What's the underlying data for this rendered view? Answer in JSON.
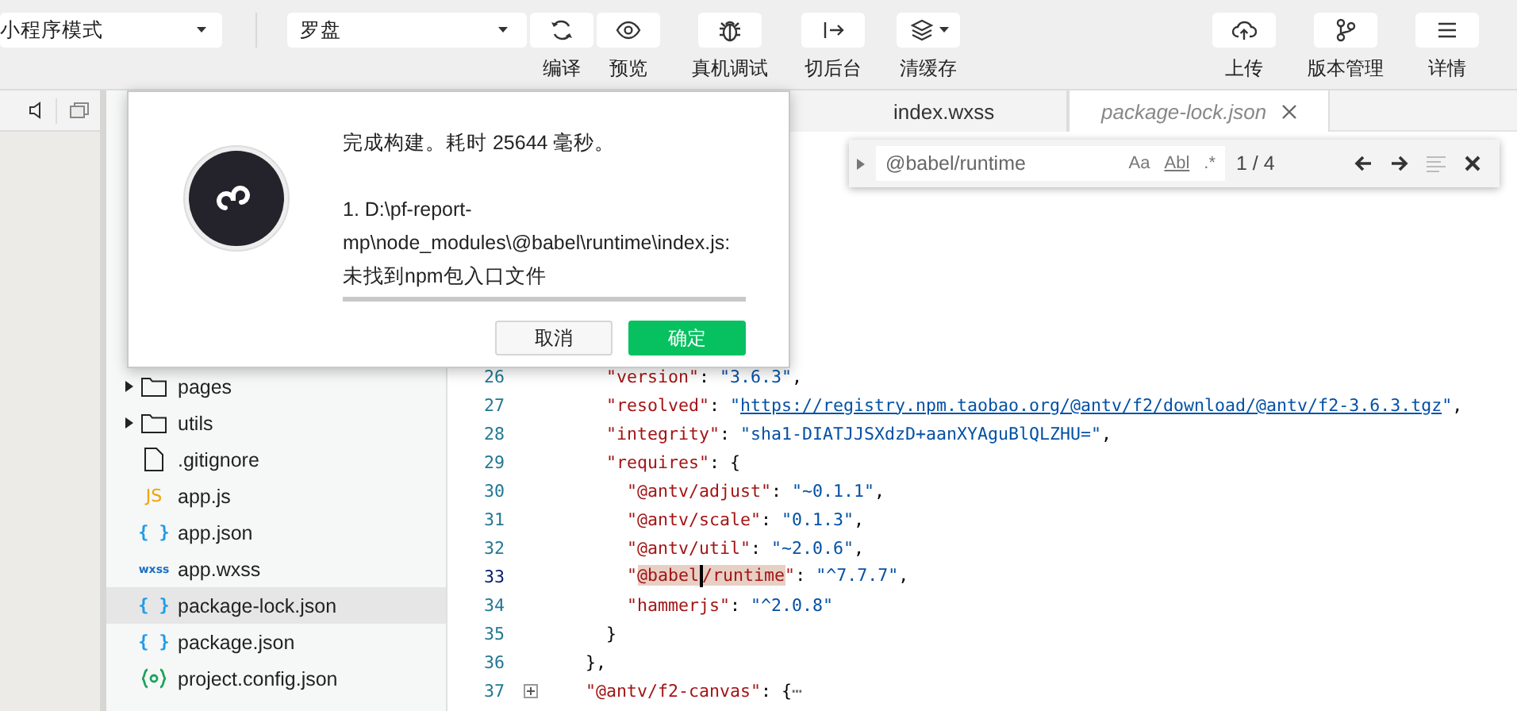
{
  "toolbar": {
    "mode_select": "小程序模式",
    "compile_select": "罗盘",
    "tools": [
      {
        "label": "编译",
        "has_menu": false
      },
      {
        "label": "预览",
        "has_menu": false
      },
      {
        "label": "真机调试",
        "has_menu": false
      },
      {
        "label": "切后台",
        "has_menu": false
      },
      {
        "label": "清缓存",
        "has_menu": true
      },
      {
        "label": "上传",
        "has_menu": false
      },
      {
        "label": "版本管理",
        "has_menu": false
      },
      {
        "label": "详情",
        "has_menu": false
      }
    ]
  },
  "file_tree": [
    {
      "name": "pages",
      "kind": "folder",
      "expanded": false,
      "selected": false
    },
    {
      "name": "utils",
      "kind": "folder",
      "expanded": false,
      "selected": false
    },
    {
      "name": ".gitignore",
      "kind": "file",
      "selected": false
    },
    {
      "name": "app.js",
      "kind": "js",
      "icon_text": "JS",
      "selected": false
    },
    {
      "name": "app.json",
      "kind": "json",
      "icon_text": "{ }",
      "selected": false
    },
    {
      "name": "app.wxss",
      "kind": "wxss",
      "icon_text": "wxss",
      "selected": false
    },
    {
      "name": "package-lock.json",
      "kind": "json",
      "icon_text": "{ }",
      "selected": true
    },
    {
      "name": "package.json",
      "kind": "json",
      "icon_text": "{ }",
      "selected": false
    },
    {
      "name": "project.config.json",
      "kind": "config",
      "selected": false
    }
  ],
  "tabs": [
    {
      "label": "index.wxss",
      "selected": false
    },
    {
      "label": "package-lock.json",
      "selected": true
    }
  ],
  "editor": {
    "lines": [
      {
        "number": "26",
        "current": false,
        "folded": false,
        "tokens": [
          {
            "kind": "key",
            "text": "      \"version\""
          },
          {
            "kind": "punct",
            "text": ": "
          },
          {
            "kind": "string",
            "text": "\"3.6.3\""
          },
          {
            "kind": "punct",
            "text": ","
          }
        ]
      },
      {
        "number": "27",
        "current": false,
        "folded": false,
        "tokens": [
          {
            "kind": "key",
            "text": "      \"resolved\""
          },
          {
            "kind": "punct",
            "text": ": "
          },
          {
            "kind": "string",
            "text": "\""
          },
          {
            "kind": "link",
            "text": "https://registry.npm.taobao.org/@antv/f2/download/@antv/f2-3.6.3.tgz"
          },
          {
            "kind": "string",
            "text": "\""
          },
          {
            "kind": "punct",
            "text": ","
          }
        ]
      },
      {
        "number": "28",
        "current": false,
        "folded": false,
        "tokens": [
          {
            "kind": "key",
            "text": "      \"integrity\""
          },
          {
            "kind": "punct",
            "text": ": "
          },
          {
            "kind": "string",
            "text": "\"sha1-DIATJJSXdzD+aanXYAguBlQLZHU=\""
          },
          {
            "kind": "punct",
            "text": ","
          }
        ]
      },
      {
        "number": "29",
        "current": false,
        "folded": false,
        "tokens": [
          {
            "kind": "key",
            "text": "      \"requires\""
          },
          {
            "kind": "punct",
            "text": ": {"
          }
        ]
      },
      {
        "number": "30",
        "current": false,
        "folded": false,
        "tokens": [
          {
            "kind": "key",
            "text": "        \"@antv/adjust\""
          },
          {
            "kind": "punct",
            "text": ": "
          },
          {
            "kind": "string",
            "text": "\"~0.1.1\""
          },
          {
            "kind": "punct",
            "text": ","
          }
        ]
      },
      {
        "number": "31",
        "current": false,
        "folded": false,
        "tokens": [
          {
            "kind": "key",
            "text": "        \"@antv/scale\""
          },
          {
            "kind": "punct",
            "text": ": "
          },
          {
            "kind": "string",
            "text": "\"0.1.3\""
          },
          {
            "kind": "punct",
            "text": ","
          }
        ]
      },
      {
        "number": "32",
        "current": false,
        "folded": false,
        "tokens": [
          {
            "kind": "key",
            "text": "        \"@antv/util\""
          },
          {
            "kind": "punct",
            "text": ": "
          },
          {
            "kind": "string",
            "text": "\"~2.0.6\""
          },
          {
            "kind": "punct",
            "text": ","
          }
        ]
      },
      {
        "number": "33",
        "current": true,
        "folded": false,
        "tokens": [
          {
            "kind": "key",
            "text": "        \""
          },
          {
            "kind": "match",
            "text": "@babel"
          },
          {
            "kind": "cursor"
          },
          {
            "kind": "match",
            "text": "/runtime"
          },
          {
            "kind": "key",
            "text": "\""
          },
          {
            "kind": "punct",
            "text": ": "
          },
          {
            "kind": "string",
            "text": "\"^7.7.7\""
          },
          {
            "kind": "punct",
            "text": ","
          }
        ]
      },
      {
        "number": "34",
        "current": false,
        "folded": false,
        "tokens": [
          {
            "kind": "key",
            "text": "        \"hammerjs\""
          },
          {
            "kind": "punct",
            "text": ": "
          },
          {
            "kind": "string",
            "text": "\"^2.0.8\""
          }
        ]
      },
      {
        "number": "35",
        "current": false,
        "folded": false,
        "tokens": [
          {
            "kind": "punct",
            "text": "      }"
          }
        ]
      },
      {
        "number": "36",
        "current": false,
        "folded": false,
        "tokens": [
          {
            "kind": "punct",
            "text": "    },"
          }
        ]
      },
      {
        "number": "37",
        "current": false,
        "folded": true,
        "tokens": [
          {
            "kind": "key",
            "text": "    \"@antv/f2-canvas\""
          },
          {
            "kind": "punct",
            "text": ": {"
          },
          {
            "kind": "ellipsis",
            "text": "⋯"
          }
        ]
      }
    ]
  },
  "find": {
    "value": "@babel/runtime",
    "options": [
      "Aa",
      "Abl",
      ".*"
    ],
    "count": "1 / 4",
    "details_expanded": false
  },
  "dialog": {
    "messages": [
      "完成构建。耗时 25644 毫秒。",
      "1. D:\\pf-report-mp\\node_modules\\@babel\\runtime\\index.js: 未找到npm包入口文件"
    ],
    "buttons": [
      {
        "label": "取消",
        "kind": "secondary"
      },
      {
        "label": "确定",
        "kind": "primary"
      }
    ]
  }
}
